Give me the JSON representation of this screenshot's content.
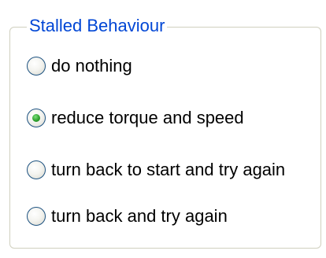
{
  "groupbox": {
    "title": "Stalled Behaviour",
    "title_color": "#0046d5",
    "border_color": "#d0d0bf"
  },
  "options": [
    {
      "label": "do nothing",
      "selected": false
    },
    {
      "label": "reduce torque and speed",
      "selected": true
    },
    {
      "label": "turn back to start and try again",
      "selected": false
    },
    {
      "label": "turn back and try again",
      "selected": false
    }
  ],
  "radio_selected_color": "#2fa22f"
}
